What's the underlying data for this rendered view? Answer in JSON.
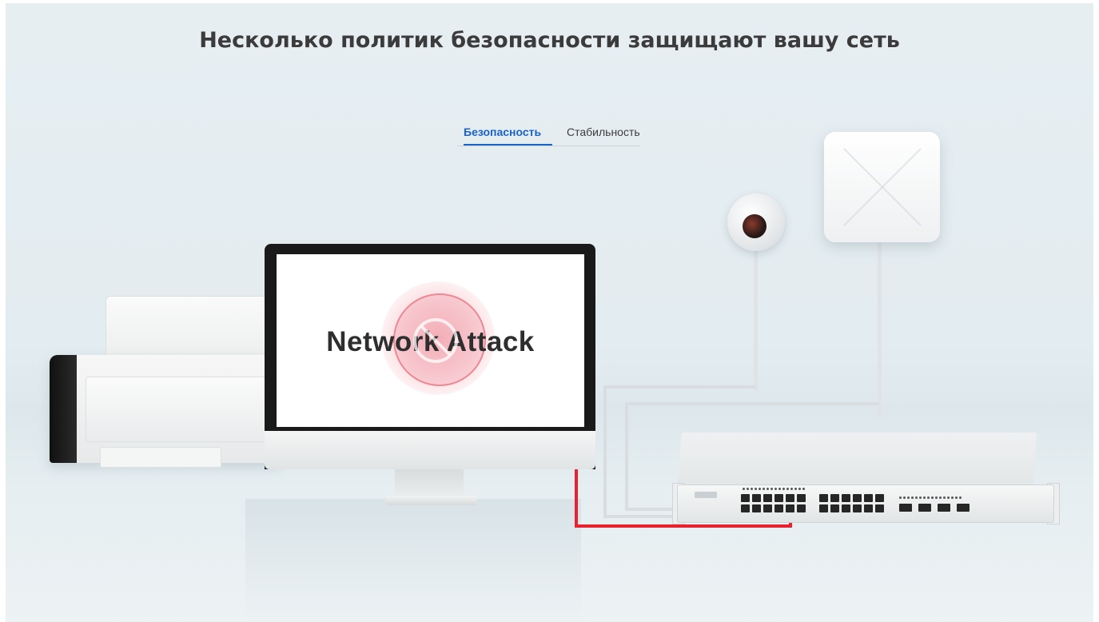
{
  "headline": "Несколько политик безопасности защищают вашу сеть",
  "tabs": [
    {
      "label": "Безопасность",
      "active": true
    },
    {
      "label": "Стабильность",
      "active": false
    }
  ],
  "screen": {
    "text": "Network Attack",
    "icon": "ban-icon"
  },
  "colors": {
    "active_tab": "#1a63c7",
    "headline": "#3b3b3b",
    "attack_cable": "#e8232f"
  }
}
